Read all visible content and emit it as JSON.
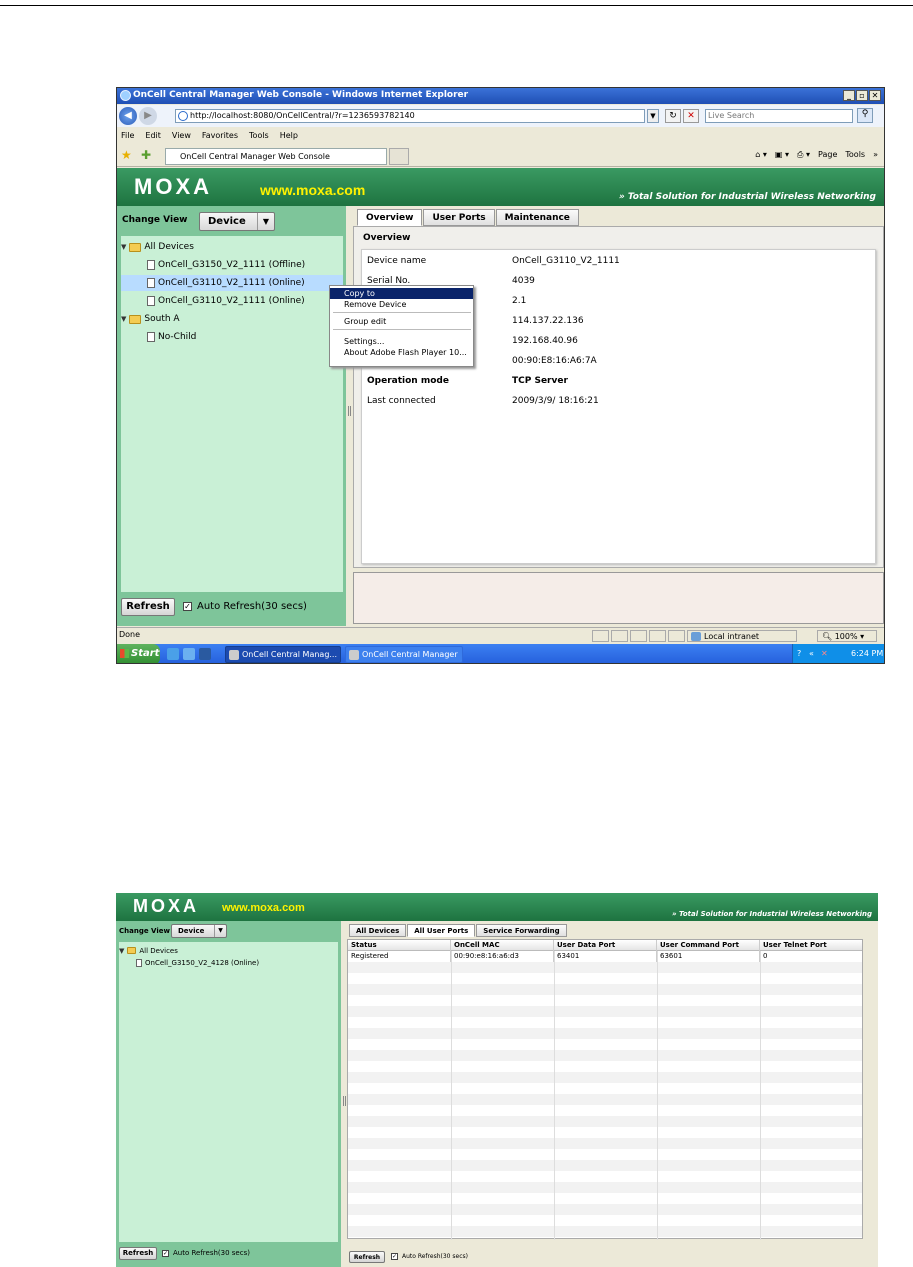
{
  "browser": {
    "window_title": "OnCell Central Manager Web Console - Windows Internet Explorer",
    "address": "http://localhost:8080/OnCellCentral/?r=1236593782140",
    "search_placeholder": "Live Search",
    "menu": [
      "File",
      "Edit",
      "View",
      "Favorites",
      "Tools",
      "Help"
    ],
    "tab_title": "OnCell Central Manager Web Console",
    "toolbar_right": [
      "Page",
      "Tools"
    ]
  },
  "banner": {
    "logo": "MOXA",
    "url": "www.moxa.com",
    "slogan": "Total Solution for Industrial Wireless Networking"
  },
  "shot1": {
    "change_view_label": "Change View",
    "view_selected": "Device",
    "tree": [
      {
        "label": "All Devices",
        "type": "folder"
      },
      {
        "label": "OnCell_G3150_V2_1111 (Offline)",
        "type": "device"
      },
      {
        "label": "OnCell_G3110_V2_1111 (Online)",
        "type": "device"
      },
      {
        "label": "OnCell_G3110_V2_1111 (Online)",
        "type": "device"
      },
      {
        "label": "South A",
        "type": "folder"
      },
      {
        "label": "No-Child",
        "type": "device"
      }
    ],
    "tabs": [
      "Overview",
      "User Ports",
      "Maintenance"
    ],
    "overview_title": "Overview",
    "overview": [
      {
        "key": "Device name",
        "value": "OnCell_G3110_V2_1111"
      },
      {
        "key": "Serial No.",
        "value": "4039"
      },
      {
        "key": "",
        "value": "2.1"
      },
      {
        "key": "",
        "value": "114.137.22.136"
      },
      {
        "key": "",
        "value": "192.168.40.96"
      },
      {
        "key": "",
        "value": "00:90:E8:16:A6:7A"
      },
      {
        "key": "Operation mode",
        "value": "TCP Server"
      },
      {
        "key": "Last connected",
        "value": "2009/3/9/ 18:16:21"
      }
    ],
    "context_menu": [
      "Copy to",
      "Remove Device",
      "Group edit",
      "Settings...",
      "About Adobe Flash Player 10..."
    ],
    "refresh_label": "Refresh",
    "auto_refresh_label": "Auto Refresh(30 secs)",
    "status_done": "Done",
    "zone": "Local intranet",
    "zoom": "100%",
    "taskbar": {
      "start": "Start",
      "tasks": [
        "OnCell Central Manag...",
        "OnCell Central Manager"
      ],
      "clock": "6:24 PM"
    }
  },
  "shot2": {
    "change_view_label": "Change View",
    "view_selected": "Device",
    "tree": [
      {
        "label": "All Devices",
        "type": "folder"
      },
      {
        "label": "OnCell_G3150_V2_4128 (Online)",
        "type": "device"
      }
    ],
    "tabs": [
      "All Devices",
      "All User Ports",
      "Service Forwarding"
    ],
    "columns": [
      "Status",
      "OnCell MAC",
      "User Data Port",
      "User Command Port",
      "User Telnet Port"
    ],
    "rows": [
      [
        "Registered",
        "00:90:e8:16:a6:d3",
        "63401",
        "63601",
        "0"
      ]
    ],
    "refresh_label": "Refresh",
    "left_auto_refresh_label": "Auto Refresh(30 secs)",
    "right_auto_refresh_label": "Auto Refresh(30 secs)"
  }
}
